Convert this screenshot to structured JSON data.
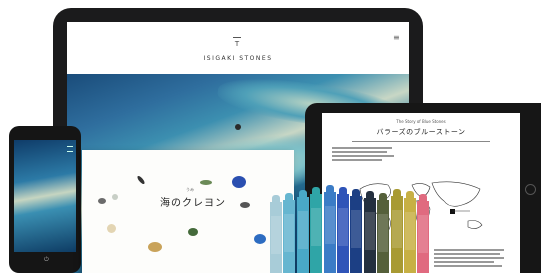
{
  "large_tablet": {
    "site_title": "ISIGAKI STONES",
    "menu_icon": "hamburger-menu-icon"
  },
  "small_tablet": {
    "kicker": "The Story of Blue Stones",
    "title": "バラーズのブルーストーン",
    "link_label": "»",
    "home_icon": "home-button-icon"
  },
  "phone": {
    "menu_icon": "hamburger-menu-icon",
    "power_icon_glyph": "⏻"
  },
  "book": {
    "ruby": "うみ",
    "title": "海のクレヨン",
    "subtitle": "",
    "footer": ""
  },
  "crayons": {
    "colors": [
      "#a8ccd8",
      "#66b6d0",
      "#49a9c7",
      "#2fa5a7",
      "#3b7cc6",
      "#2f54b8",
      "#1c3f84",
      "#24303f",
      "#55603a",
      "#a89a33",
      "#c7b044",
      "#e06a7f"
    ]
  }
}
